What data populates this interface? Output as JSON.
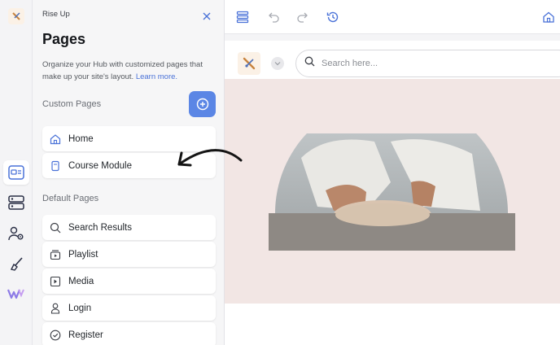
{
  "panel": {
    "site_name": "Rise Up",
    "title": "Pages",
    "description": "Organize your Hub with customized pages that make up your site's layout.",
    "learn_more": "Learn more.",
    "custom_section": "Custom Pages",
    "default_section": "Default Pages",
    "custom_pages": [
      {
        "label": "Home",
        "icon": "home-icon"
      },
      {
        "label": "Course Module",
        "icon": "document-icon"
      }
    ],
    "default_pages": [
      {
        "label": "Search Results",
        "icon": "search-icon"
      },
      {
        "label": "Playlist",
        "icon": "playlist-icon"
      },
      {
        "label": "Media",
        "icon": "media-icon"
      },
      {
        "label": "Login",
        "icon": "user-icon"
      },
      {
        "label": "Register",
        "icon": "check-circle-icon"
      }
    ]
  },
  "rail": {
    "items": [
      "pages-icon",
      "sections-icon",
      "users-settings-icon",
      "brush-icon",
      "brand-logo-icon"
    ],
    "active": "pages-icon"
  },
  "toolbar": {
    "icons": [
      "layers-icon",
      "undo-icon",
      "redo-icon",
      "history-icon",
      "home-icon"
    ]
  },
  "preview": {
    "search_placeholder": "Search here..."
  },
  "colors": {
    "accent": "#5b86e5",
    "hero_bg": "#f2e6e4",
    "link": "#4a72d8"
  }
}
